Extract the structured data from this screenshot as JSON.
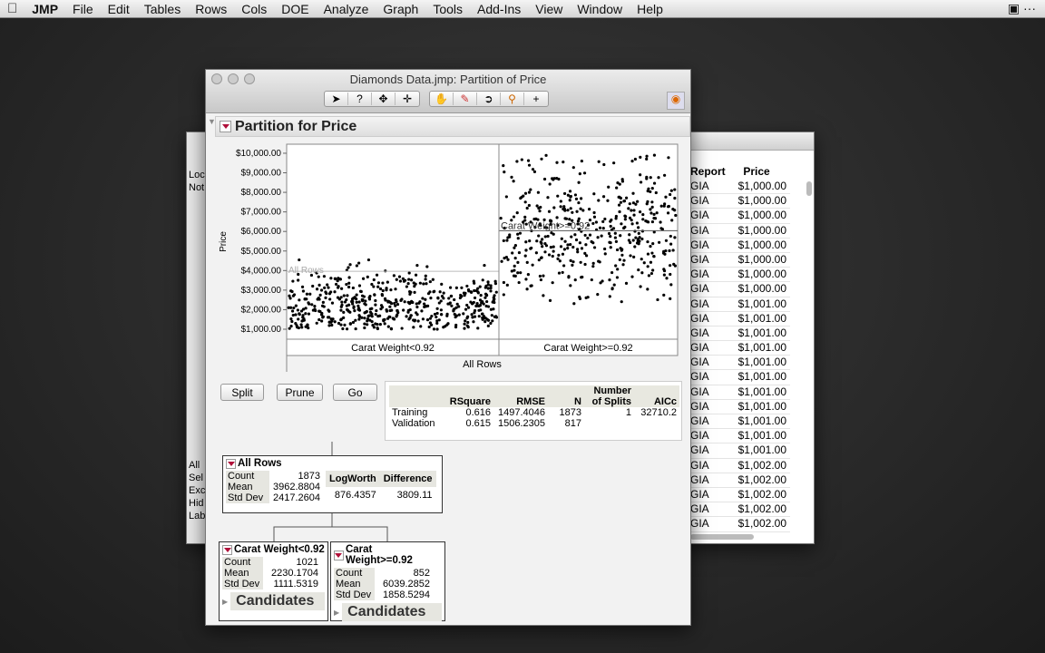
{
  "menubar": {
    "app": "JMP",
    "items": [
      "File",
      "Edit",
      "Tables",
      "Rows",
      "Cols",
      "DOE",
      "Analyze",
      "Graph",
      "Tools",
      "Add-Ins",
      "View",
      "Window",
      "Help"
    ]
  },
  "window": {
    "title": "Diamonds Data.jmp: Partition of Price",
    "toolbar_group1": [
      "arrow-tool",
      "help-tool",
      "selection-tool",
      "crosshair-tool"
    ],
    "toolbar_group2": [
      "hand-tool",
      "brush-tool",
      "lasso-tool",
      "magnifier-tool",
      "annotate-tool"
    ]
  },
  "report": {
    "title": "Partition for Price"
  },
  "chart_data": {
    "type": "scatter",
    "ylabel": "Price",
    "yticks": [
      "$1,000.00",
      "$2,000.00",
      "$3,000.00",
      "$4,000.00",
      "$5,000.00",
      "$6,000.00",
      "$7,000.00",
      "$8,000.00",
      "$9,000.00",
      "$10,000.00"
    ],
    "ylim": [
      1000,
      10000
    ],
    "partitions": [
      {
        "label": "Carat Weight<0.92",
        "count": 1021,
        "mean": 2230.1704
      },
      {
        "label": "Carat Weight>=0.92",
        "count": 852,
        "mean": 6039.2852
      }
    ],
    "root_label": "All Rows",
    "mean_line_labels": [
      "All Rows",
      "Carat Weight>=0.92"
    ],
    "overall_mean": 3962.8804
  },
  "buttons": {
    "split": "Split",
    "prune": "Prune",
    "go": "Go"
  },
  "fit": {
    "headers": [
      "",
      "RSquare",
      "RMSE",
      "N",
      "Number of Splits",
      "AICc"
    ],
    "rows": [
      [
        "Training",
        "0.616",
        "1497.4046",
        "1873",
        "1",
        "32710.2"
      ],
      [
        "Validation",
        "0.615",
        "1506.2305",
        "817",
        "",
        ""
      ]
    ]
  },
  "tree": {
    "root": {
      "title": "All Rows",
      "stats": [
        [
          "Count",
          "1873"
        ],
        [
          "Mean",
          "3962.8804"
        ],
        [
          "Std Dev",
          "2417.2604"
        ]
      ],
      "split_headers": [
        "LogWorth",
        "Difference"
      ],
      "split_values": [
        "876.4357",
        "3809.11"
      ]
    },
    "children": [
      {
        "title": "Carat Weight<0.92",
        "stats": [
          [
            "Count",
            "1021"
          ],
          [
            "Mean",
            "2230.1704"
          ],
          [
            "Std Dev",
            "1111.5319"
          ]
        ],
        "candidates": "Candidates"
      },
      {
        "title": "Carat Weight>=0.92",
        "stats": [
          [
            "Count",
            "852"
          ],
          [
            "Mean",
            "6039.2852"
          ],
          [
            "Std Dev",
            "1858.5294"
          ]
        ],
        "candidates": "Candidates"
      }
    ]
  },
  "data_table": {
    "columns": [
      "Report",
      "Price"
    ],
    "rows": [
      [
        "GIA",
        "$1,000.00"
      ],
      [
        "GIA",
        "$1,000.00"
      ],
      [
        "GIA",
        "$1,000.00"
      ],
      [
        "GIA",
        "$1,000.00"
      ],
      [
        "GIA",
        "$1,000.00"
      ],
      [
        "GIA",
        "$1,000.00"
      ],
      [
        "GIA",
        "$1,000.00"
      ],
      [
        "GIA",
        "$1,000.00"
      ],
      [
        "GIA",
        "$1,001.00"
      ],
      [
        "GIA",
        "$1,001.00"
      ],
      [
        "GIA",
        "$1,001.00"
      ],
      [
        "GIA",
        "$1,001.00"
      ],
      [
        "GIA",
        "$1,001.00"
      ],
      [
        "GIA",
        "$1,001.00"
      ],
      [
        "GIA",
        "$1,001.00"
      ],
      [
        "GIA",
        "$1,001.00"
      ],
      [
        "GIA",
        "$1,001.00"
      ],
      [
        "GIA",
        "$1,001.00"
      ],
      [
        "GIA",
        "$1,001.00"
      ],
      [
        "GIA",
        "$1,002.00"
      ],
      [
        "GIA",
        "$1,002.00"
      ],
      [
        "GIA",
        "$1,002.00"
      ],
      [
        "GIA",
        "$1,002.00"
      ],
      [
        "GIA",
        "$1,002.00"
      ]
    ]
  },
  "left_panel": {
    "lines": [
      "Loc",
      "Not",
      "All",
      "Sel",
      "Exc",
      "Hid",
      "Lab"
    ]
  }
}
